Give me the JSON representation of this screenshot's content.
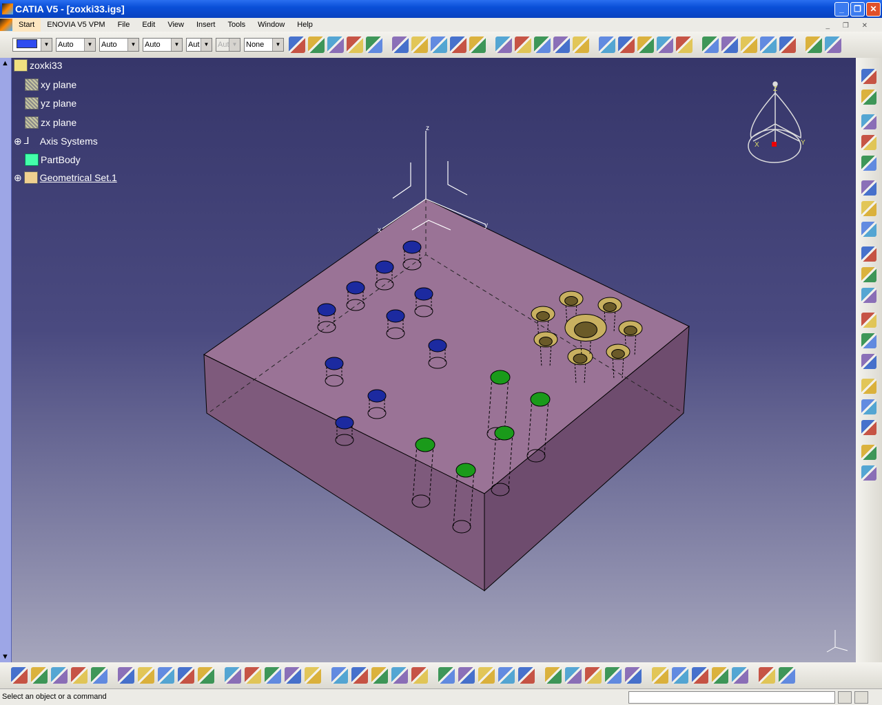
{
  "window": {
    "title": "CATIA V5 - [zoxki33.igs]",
    "minimize": "_",
    "restore": "❐",
    "close": "✕"
  },
  "menu": [
    "Start",
    "ENOVIA V5 VPM",
    "File",
    "Edit",
    "View",
    "Insert",
    "Tools",
    "Window",
    "Help"
  ],
  "graphic_props": {
    "color": "#2f4cf0",
    "line_type": "Auto",
    "thickness": "Auto",
    "point": "Auto",
    "layer": "Aut",
    "layer2": "Aut",
    "rendering": "None"
  },
  "tree": {
    "root": "zoxki33",
    "items": [
      "xy plane",
      "yz plane",
      "zx plane",
      "Axis Systems",
      "PartBody",
      "Geometrical Set.1"
    ]
  },
  "compass": {
    "x": "X",
    "y": "Y",
    "z": "Z"
  },
  "model_axes": {
    "x": "x",
    "y": "y",
    "z": "z"
  },
  "top_icons": [
    "paint-brush-icon",
    "apply-material-icon",
    "point-icon",
    "line-icon",
    "plane-icon",
    "projection-icon",
    "intersection-icon",
    "boundary-icon",
    "extract-icon",
    "join-icon",
    "healing-icon",
    "split-icon",
    "trim-icon",
    "translate-icon",
    "rotate-icon",
    "symmetry-icon",
    "pattern-icon",
    "grid-icon",
    "scaling-icon",
    "affinity-icon",
    "axis-to-axis-icon",
    "sketcher-icon",
    "boolean-icon",
    "fillet-icon",
    "curve-icon",
    "surface-icon",
    "hole-icon"
  ],
  "right_icons": [
    "workbench-icon",
    "select-icon",
    "snap-icon",
    "sketch-icon",
    "point-icon",
    "line-icon",
    "plane-icon",
    "extrude-icon",
    "revolve-icon",
    "sweep-icon",
    "circle-icon",
    "spline-icon",
    "law-icon",
    "offset-icon",
    "fill-icon",
    "blend-icon",
    "loft-icon",
    "multi-section-icon",
    "draft-icon"
  ],
  "bottom_icons": [
    "new-icon",
    "open-icon",
    "save-icon",
    "print-icon",
    "cut-icon",
    "copy-icon",
    "paste-icon",
    "undo-icon",
    "redo-icon",
    "whats-this-icon",
    "formula-icon",
    "comment-icon",
    "lock-icon",
    "table-icon",
    "tree-icon",
    "catalog-icon",
    "knowledge-icon",
    "fly-mode-icon",
    "fit-all-icon",
    "pan-icon",
    "rotate-view-icon",
    "zoom-in-icon",
    "zoom-out-icon",
    "normal-view-icon",
    "isometric-view-icon",
    "multi-view-icon",
    "hide-show-icon",
    "swap-visible-icon",
    "render-style-icon",
    "measure-icon",
    "measure-item-icon",
    "mass-icon",
    "capture-icon",
    "update-icon",
    "hand-icon",
    "axis-icon",
    "spec-tree-icon"
  ],
  "status": {
    "text": "Select an object or a command"
  },
  "colors": {
    "part": "#9a7396",
    "blue_holes": "#1c2aa0",
    "green_holes": "#1a9a1a",
    "gold_holes": "#c8b060",
    "background_top": "#36366a",
    "background_bottom": "#a6a6bc"
  }
}
